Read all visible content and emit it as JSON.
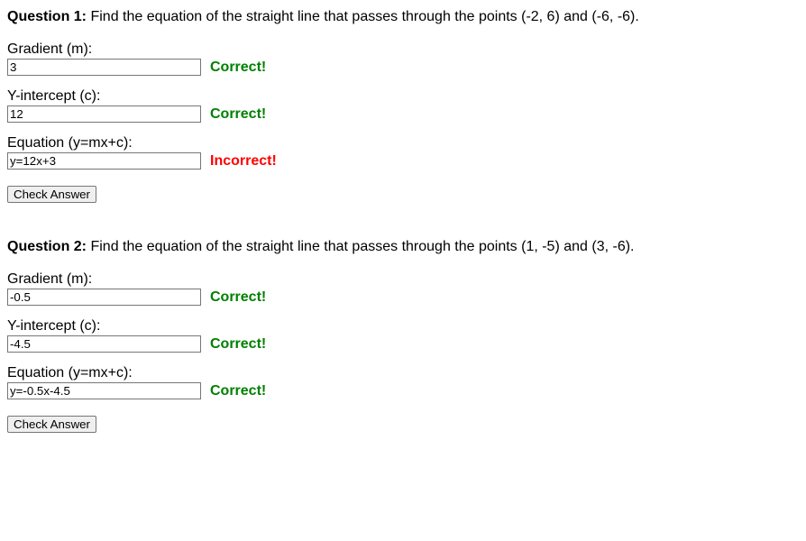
{
  "questions": [
    {
      "label": "Question 1:",
      "prompt": " Find the equation of the straight line that passes through the points (-2, 6) and (-6, -6).",
      "gradient": {
        "label": "Gradient (m):",
        "value": "3",
        "feedback": "Correct!",
        "feedback_status": "correct"
      },
      "intercept": {
        "label": "Y-intercept (c):",
        "value": "12",
        "feedback": "Correct!",
        "feedback_status": "correct"
      },
      "equation": {
        "label": "Equation (y=mx+c):",
        "value": "y=12x+3",
        "feedback": "Incorrect!",
        "feedback_status": "incorrect"
      },
      "check_button": "Check Answer"
    },
    {
      "label": "Question 2:",
      "prompt": " Find the equation of the straight line that passes through the points (1, -5) and (3, -6).",
      "gradient": {
        "label": "Gradient (m):",
        "value": "-0.5",
        "feedback": "Correct!",
        "feedback_status": "correct"
      },
      "intercept": {
        "label": "Y-intercept (c):",
        "value": "-4.5",
        "feedback": "Correct!",
        "feedback_status": "correct"
      },
      "equation": {
        "label": "Equation (y=mx+c):",
        "value": "y=-0.5x-4.5",
        "feedback": "Correct!",
        "feedback_status": "correct"
      },
      "check_button": "Check Answer"
    }
  ]
}
